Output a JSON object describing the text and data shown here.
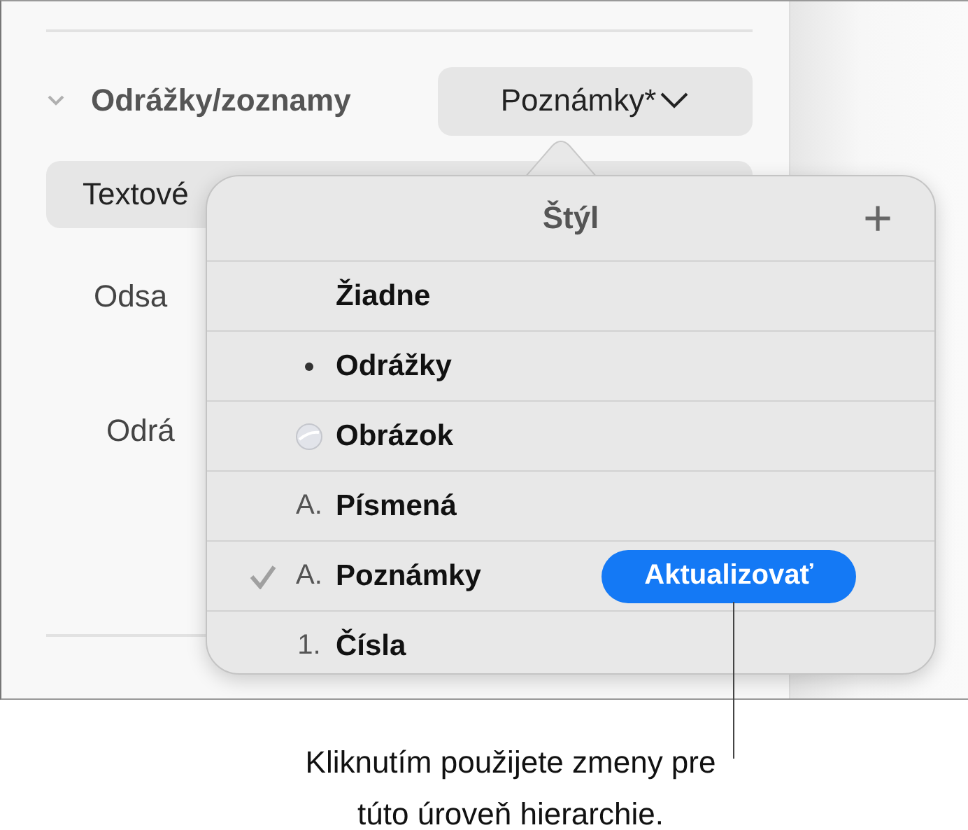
{
  "inspector": {
    "section": {
      "title": "Odrážky/zoznamy",
      "expanded": true,
      "style_popup": "Poznámky*"
    },
    "text_button": "Textové",
    "labels": [
      "Odsa",
      "Odrá"
    ]
  },
  "popover": {
    "title": "Štýl",
    "add": "+",
    "items": [
      {
        "kind": "none",
        "label": "Žiadne",
        "checked": false
      },
      {
        "kind": "bullet",
        "label": "Odrážky",
        "checked": false
      },
      {
        "kind": "image",
        "label": "Obrázok",
        "checked": false
      },
      {
        "kind": "text",
        "marker": "A.",
        "label": "Písmená",
        "checked": false
      },
      {
        "kind": "text",
        "marker": "A.",
        "label": "Poznámky",
        "checked": true,
        "button": "Aktualizovať"
      },
      {
        "kind": "text",
        "marker": "1.",
        "label": "Čísla",
        "checked": false
      }
    ]
  },
  "callout": "Kliknutím použijete zmeny pre túto úroveň hierarchie."
}
